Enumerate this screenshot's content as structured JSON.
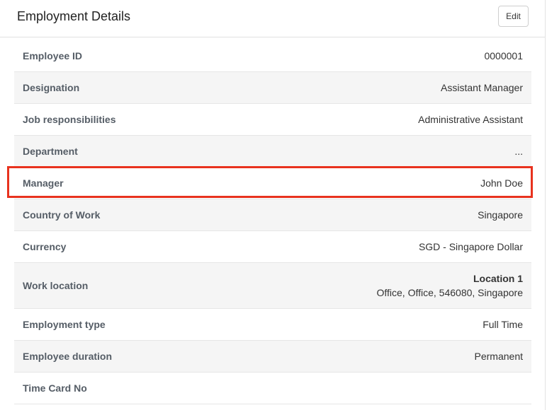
{
  "card": {
    "title": "Employment Details",
    "edit_label": "Edit"
  },
  "rows": [
    {
      "label": "Employee ID",
      "value": "0000001"
    },
    {
      "label": "Designation",
      "value": "Assistant Manager"
    },
    {
      "label": "Job responsibilities",
      "value": "Administrative Assistant"
    },
    {
      "label": "Department",
      "value": "..."
    },
    {
      "label": "Manager",
      "value": "John Doe"
    },
    {
      "label": "Country of Work",
      "value": "Singapore"
    },
    {
      "label": "Currency",
      "value": "SGD - Singapore Dollar"
    },
    {
      "label": "Work location",
      "value_title": "Location 1",
      "value": "Office, Office, 546080, Singapore"
    },
    {
      "label": "Employment type",
      "value": "Full Time"
    },
    {
      "label": "Employee duration",
      "value": "Permanent"
    },
    {
      "label": "Time Card No",
      "value": ""
    }
  ],
  "highlight_color": "#e8321e"
}
